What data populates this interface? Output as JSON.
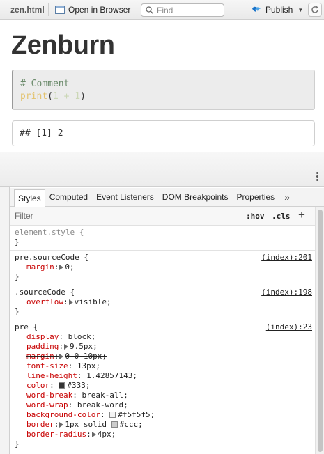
{
  "toolbar": {
    "file_name": "zen.html",
    "open_in_browser": "Open in Browser",
    "find_placeholder": "Find",
    "publish": "Publish"
  },
  "document": {
    "title": "Zenburn",
    "code_comment": "# Comment",
    "code_func": "print",
    "code_open": "(",
    "code_num1": "1",
    "code_op": " + ",
    "code_num2": "1",
    "code_close": ")",
    "output": "## [1] 2"
  },
  "devtools": {
    "tabs": [
      "Styles",
      "Computed",
      "Event Listeners",
      "DOM Breakpoints",
      "Properties"
    ],
    "tab_overflow": "»",
    "filter_placeholder": "Filter",
    "hov": ":hov",
    "cls": ".cls",
    "add": "+",
    "close_brace": "}",
    "rules": [
      {
        "selector": "element.style {",
        "source": ""
      },
      {
        "selector": "pre.sourceCode {",
        "source": "(index):201",
        "decls": [
          {
            "prop": "margin",
            "value": "0;"
          }
        ]
      },
      {
        "selector": ".sourceCode {",
        "source": "(index):198",
        "decls": [
          {
            "prop": "overflow",
            "value": "visible;"
          }
        ]
      },
      {
        "selector": "pre {",
        "source": "(index):23",
        "decls": [
          {
            "prop": "display",
            "value": "block;"
          },
          {
            "prop": "padding",
            "value": "9.5px;"
          },
          {
            "prop": "margin",
            "value": "0 0 10px;"
          },
          {
            "prop": "font-size",
            "value": "13px;"
          },
          {
            "prop": "line-height",
            "value": "1.42857143;"
          },
          {
            "prop": "color",
            "value": "#333;"
          },
          {
            "prop": "word-break",
            "value": "break-all;"
          },
          {
            "prop": "word-wrap",
            "value": "break-word;"
          },
          {
            "prop": "background-color",
            "value": "#f5f5f5;"
          },
          {
            "prop": "border",
            "value": "1px solid",
            "value2": "#ccc;"
          },
          {
            "prop": "border-radius",
            "value": "4px;"
          }
        ]
      }
    ]
  },
  "colors": {
    "swatch_333": "#333333",
    "swatch_f5f5f5": "#f5f5f5",
    "swatch_ccc": "#cccccc",
    "css_property": "#c80000",
    "publish_icon": "#1a73c9"
  }
}
